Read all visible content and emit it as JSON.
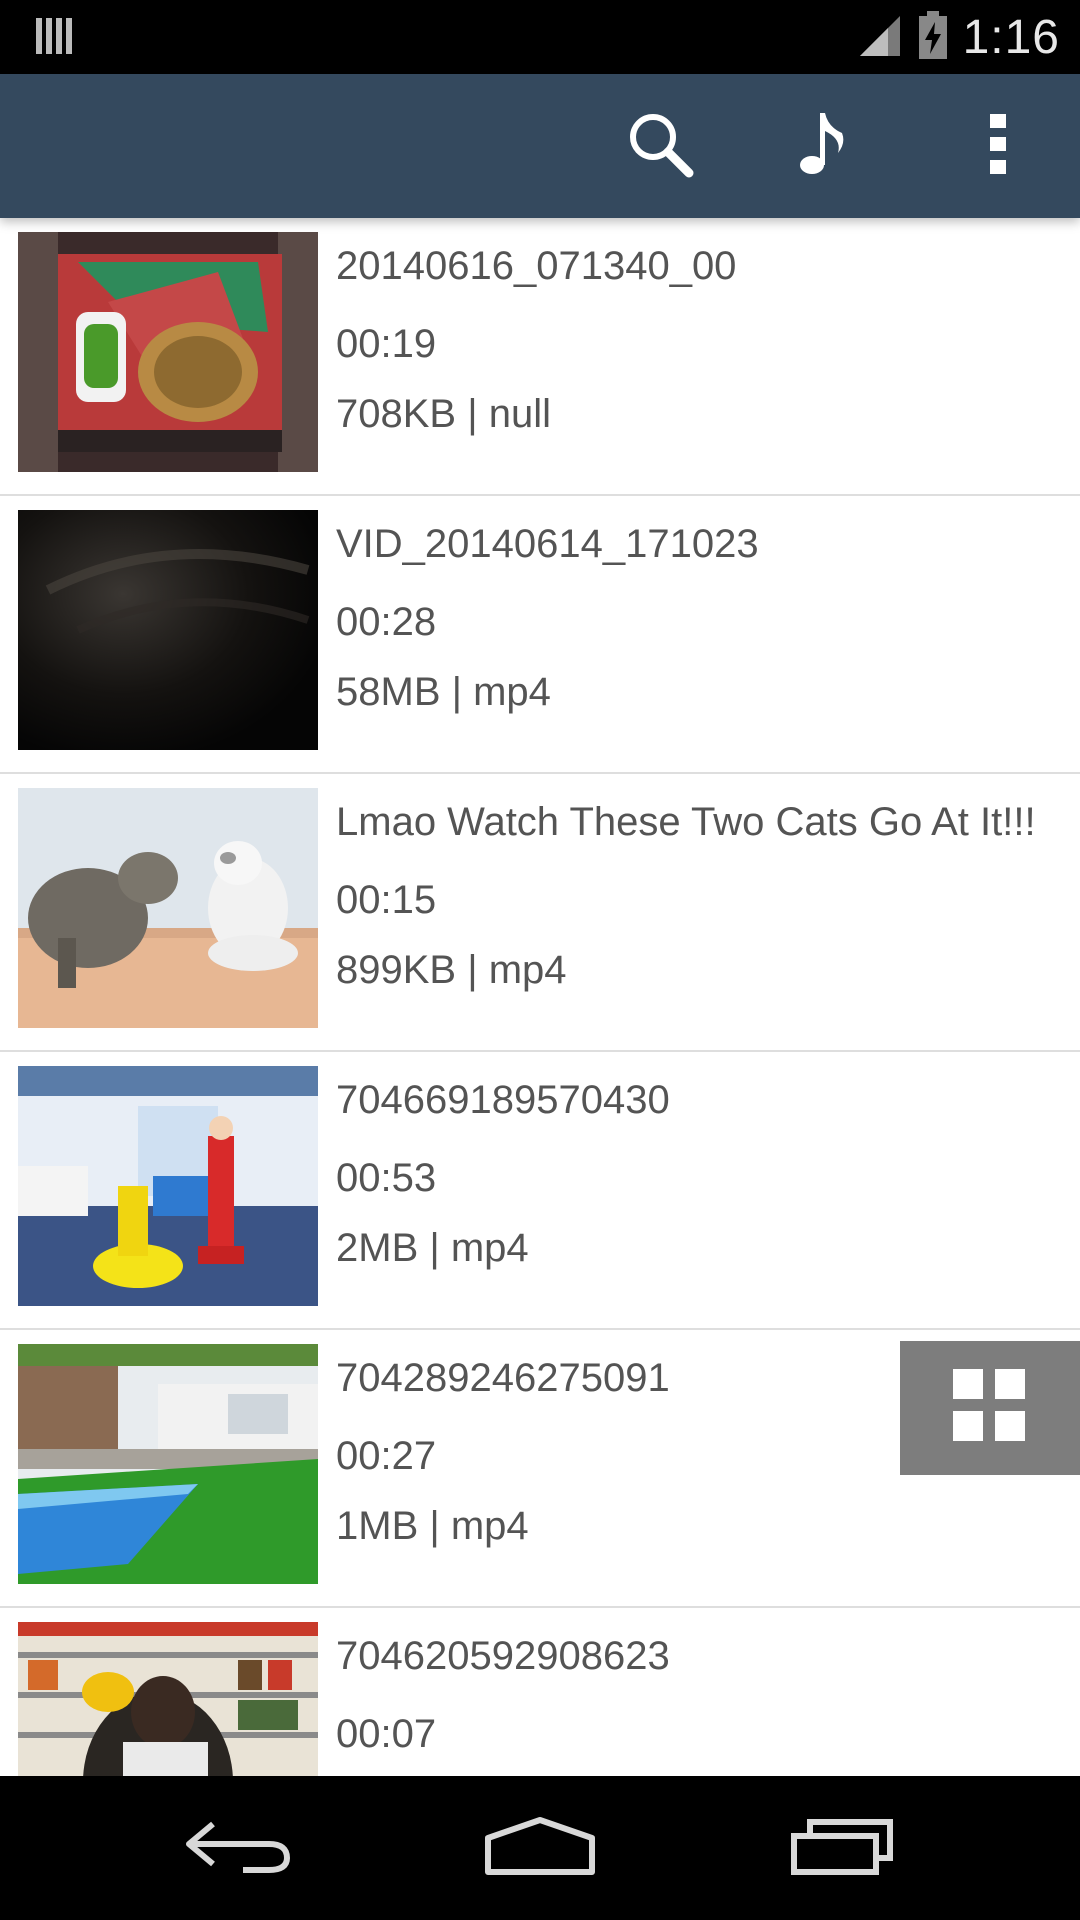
{
  "status_bar": {
    "time": "1:16",
    "icons": [
      "notification-icon",
      "signal-icon",
      "battery-charging-icon"
    ]
  },
  "app_bar": {
    "actions": [
      "search-icon",
      "music-note-icon",
      "overflow-menu-icon"
    ]
  },
  "videos": [
    {
      "title": "20140616_071340_00",
      "duration": "00:19",
      "size": "708KB | null",
      "thumbnail": "food-on-rug"
    },
    {
      "title": "VID_20140614_171023",
      "duration": "00:28",
      "size": "58MB | mp4",
      "thumbnail": "dark-blur"
    },
    {
      "title": "Lmao Watch These Two Cats Go At It!!!",
      "duration": "00:15",
      "size": "899KB | mp4",
      "thumbnail": "two-cats"
    },
    {
      "title": "704669189570430",
      "duration": "00:53",
      "size": "2MB | mp4",
      "thumbnail": "martial-arts"
    },
    {
      "title": "704289246275091",
      "duration": "00:27",
      "size": "1MB | mp4",
      "thumbnail": "pool-lawn"
    },
    {
      "title": "704620592908623",
      "duration": "00:07",
      "size": "",
      "thumbnail": "store-shelf"
    }
  ],
  "grid_toggle": {
    "icon": "grid-view-icon"
  },
  "nav_bar": {
    "buttons": [
      "back-icon",
      "home-icon",
      "recents-icon"
    ]
  },
  "colors": {
    "app_bar": "#34495e",
    "status_bar": "#000000",
    "list_background": "#ffffff",
    "text": "#545454",
    "grid_toggle": "#7d7d7d"
  }
}
